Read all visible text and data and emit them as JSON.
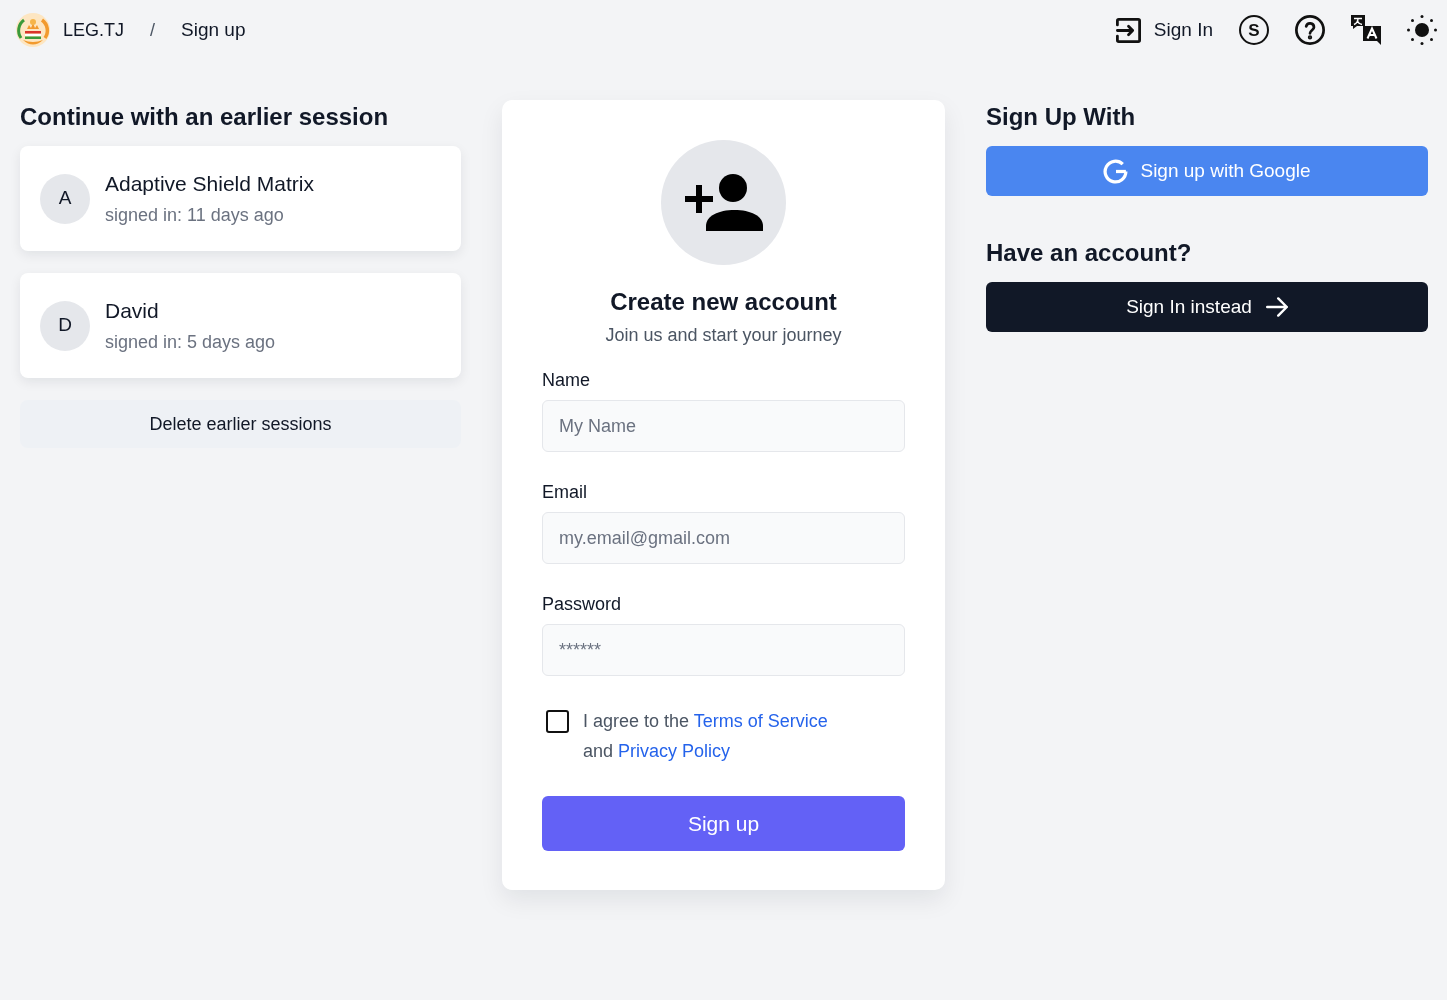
{
  "header": {
    "brand": "LEG.TJ",
    "separator": "/",
    "page": "Sign up",
    "sign_in_link": "Sign In",
    "circled_letter": "S"
  },
  "earlier_sessions": {
    "title": "Continue with an earlier session",
    "sessions": [
      {
        "initial": "A",
        "name": "Adaptive Shield Matrix",
        "signed_in": "signed in: 11 days ago"
      },
      {
        "initial": "D",
        "name": "David",
        "signed_in": "signed in: 5 days ago"
      }
    ],
    "delete_button": "Delete earlier sessions"
  },
  "signup_form": {
    "title": "Create new account",
    "subtitle": "Join us and start your journey",
    "fields": [
      {
        "label": "Name",
        "placeholder": "My Name"
      },
      {
        "label": "Email",
        "placeholder": "my.email@gmail.com"
      },
      {
        "label": "Password",
        "placeholder": "******"
      }
    ],
    "agreement": {
      "checked": false,
      "parts": [
        {
          "kind": "text",
          "text": "I agree to the "
        },
        {
          "kind": "link",
          "text": "Terms of Service"
        },
        {
          "kind": "text",
          "text": " and "
        },
        {
          "kind": "link",
          "text": "Privacy Policy"
        }
      ]
    },
    "submit_button": "Sign up"
  },
  "side_panel": {
    "signup_with_title": "Sign Up With",
    "google_button": "Sign up with Google",
    "account_title": "Have an account?",
    "sign_in_button": "Sign In instead"
  }
}
